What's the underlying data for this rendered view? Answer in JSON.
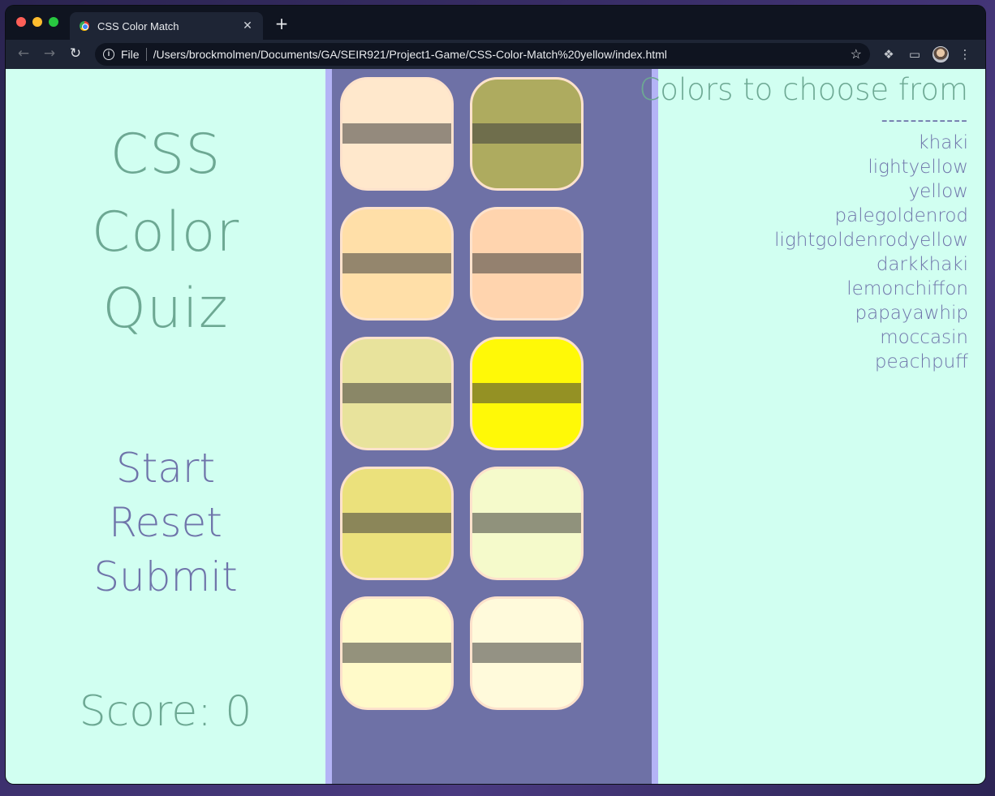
{
  "browser": {
    "tab_title": "CSS Color Match",
    "tab_close": "✕",
    "new_tab": "+",
    "file_label": "File",
    "url": "/Users/brockmolmen/Documents/GA/SEIR921/Project1-Game/CSS-Color-Match%20yellow/index.html"
  },
  "game": {
    "title_lines": [
      "CSS",
      "Color",
      "Quiz"
    ],
    "actions": {
      "start": "Start",
      "reset": "Reset",
      "submit": "Submit"
    },
    "score": "Score: 0"
  },
  "cards": [
    {
      "color": "#ffe8cc"
    },
    {
      "color": "#aeab5f"
    },
    {
      "color": "#ffdfa8"
    },
    {
      "color": "#ffd4ae"
    },
    {
      "color": "#e8e39c"
    },
    {
      "color": "#fff907"
    },
    {
      "color": "#ebe17c"
    },
    {
      "color": "#f5facb"
    },
    {
      "color": "#fffac9"
    },
    {
      "color": "#fffadb"
    }
  ],
  "sidebar": {
    "title": "Colors to choose from",
    "divider": "------------",
    "colors": [
      "khaki",
      "lightyellow",
      "yellow",
      "palegoldenrod",
      "lightgoldenrodyellow",
      "darkkhaki",
      "lemonchiffon",
      "papayawhip",
      "moccasin",
      "peachpuff"
    ]
  }
}
